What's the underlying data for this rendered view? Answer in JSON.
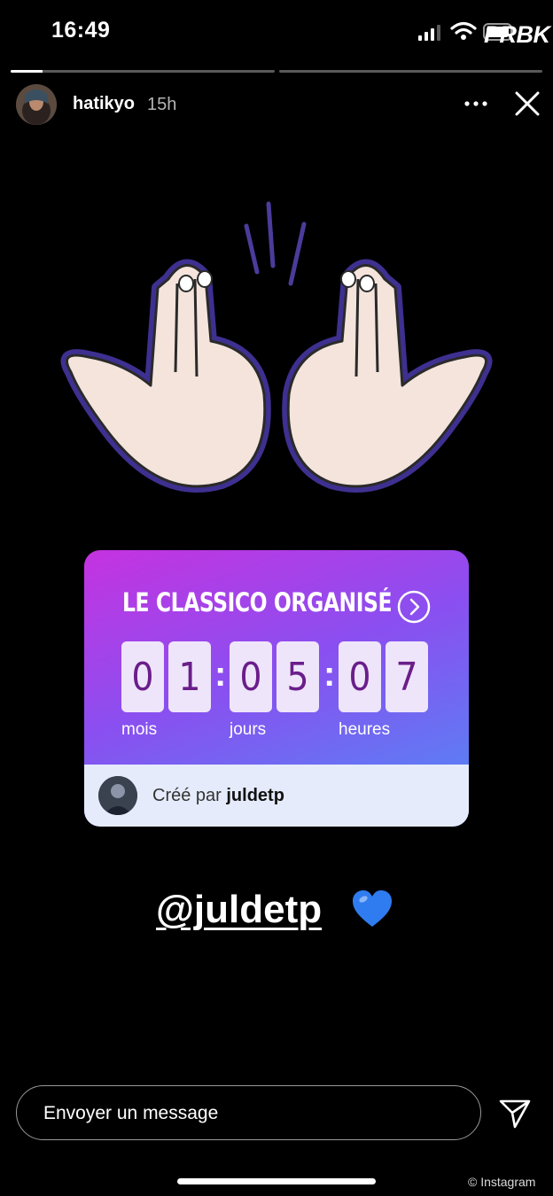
{
  "status_bar": {
    "time": "16:49",
    "watermark": "PRBK"
  },
  "story": {
    "progress": [
      0.12,
      0
    ],
    "username": "hatikyo",
    "age": "15h"
  },
  "countdown": {
    "title": "LE CLASSICO ORGANISÉ",
    "digits": [
      "0",
      "1",
      "0",
      "5",
      "0",
      "7"
    ],
    "units": {
      "months": "mois",
      "days": "jours",
      "hours": "heures"
    },
    "created_prefix": "Créé par",
    "creator": "juldetp"
  },
  "mention": {
    "text": "@juldetp",
    "emoji": "blue-heart"
  },
  "reply": {
    "placeholder": "Envoyer un message"
  },
  "credit": "© Instagram",
  "colors": {
    "card_start": "#c533e0",
    "card_end": "#4e8cf5",
    "digit_text": "#6a1e8a",
    "hand_outline": "#4a3c9a",
    "heart": "#2f7cf0"
  }
}
